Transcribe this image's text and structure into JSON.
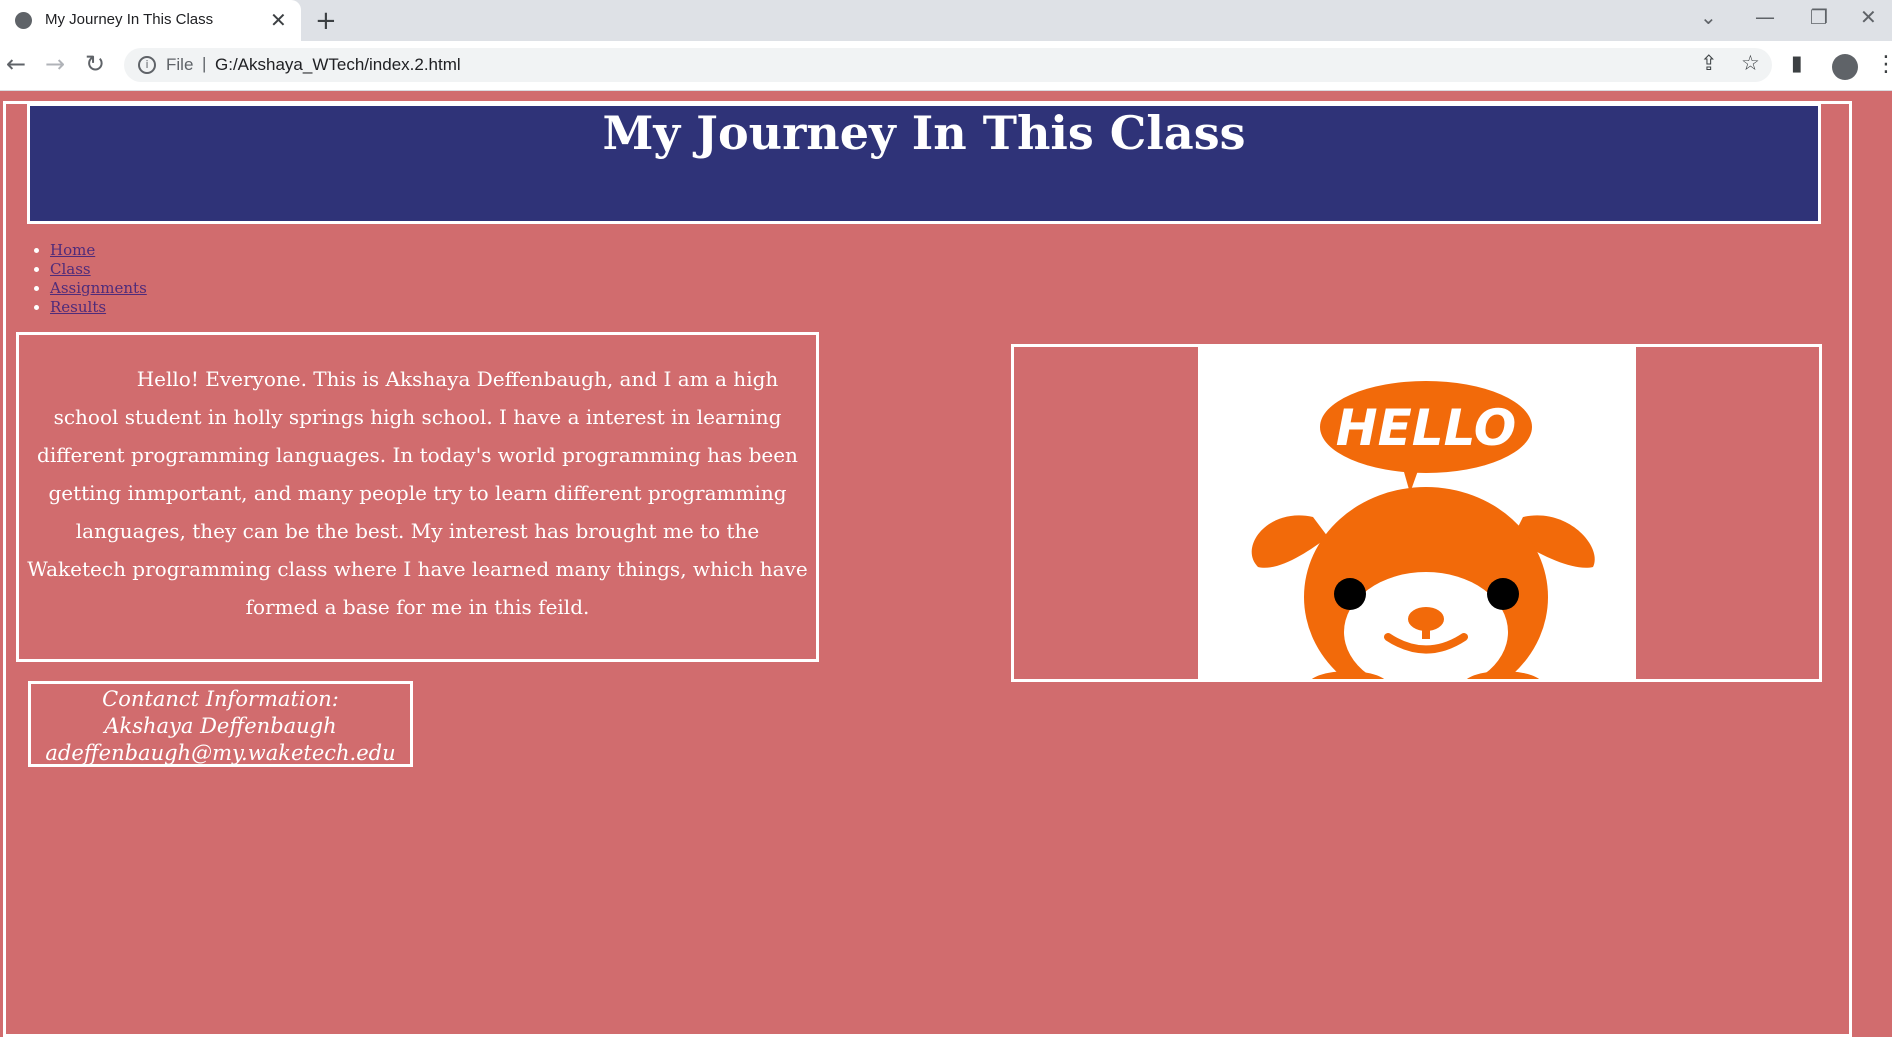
{
  "browser": {
    "tab_title": "My Journey In This Class",
    "tab_close": "✕",
    "new_tab": "+",
    "scheme": "File",
    "url": "G:/Akshaya_WTech/index.2.html",
    "controls": {
      "dropdown": "⌄",
      "minimize": "—",
      "restore": "❐",
      "close": "✕"
    }
  },
  "page": {
    "heading": "My Journey In This Class",
    "nav": [
      "Home",
      "Class",
      "Assignments",
      "Results"
    ],
    "intro": "Hello! Everyone. This is Akshaya Deffenbaugh, and I am a high school student in holly springs high school. I have a interest in learning different programming languages. In today's world programming has been getting inmportant, and many people try to learn different programming languages, they can be the best. My interest has brought me to the Waketech programming class where I have learned many things, which have formed a base for me in this feild.",
    "contact": {
      "heading": "Contanct Information:",
      "name": "Akshaya Deffenbaugh",
      "email": "adeffenbaugh@my.waketech.edu"
    },
    "image_text": "HELLO"
  },
  "colors": {
    "page_bg": "#d16c6e",
    "header_bg": "#2f3378",
    "dog_orange": "#f26a0a",
    "link": "#4f2b7a"
  }
}
